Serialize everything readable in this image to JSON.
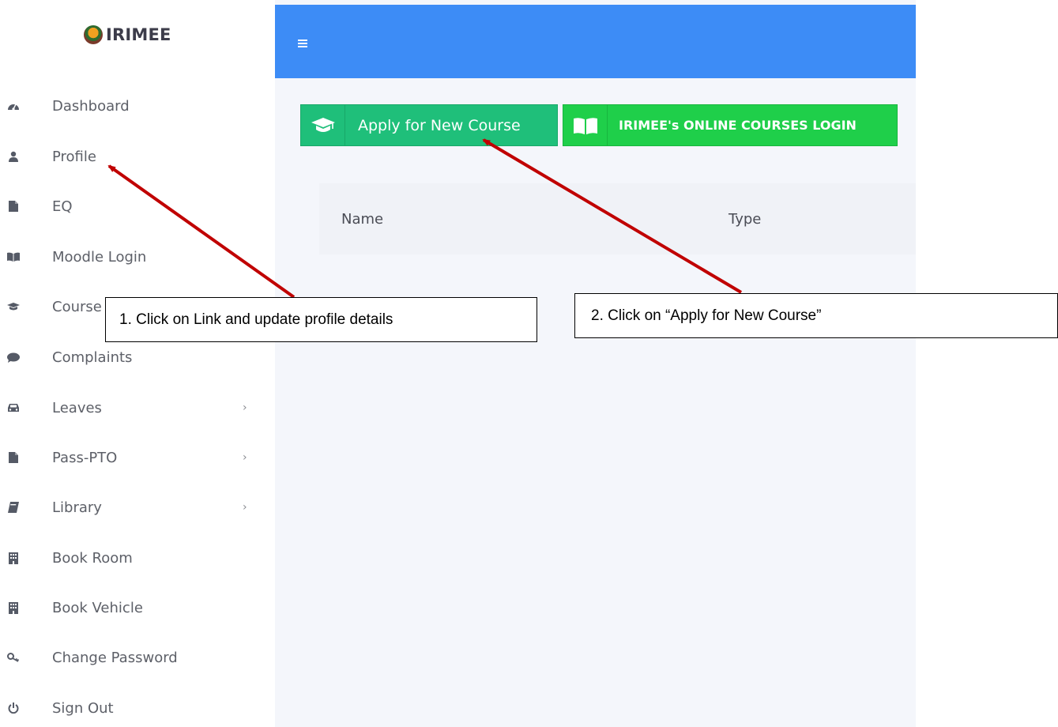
{
  "sidebar": {
    "logo_text": "IRIMEE",
    "items": [
      {
        "label": "Dashboard",
        "icon": "dashboard-icon",
        "has_submenu": false
      },
      {
        "label": "Profile",
        "icon": "user-icon",
        "has_submenu": false
      },
      {
        "label": "EQ",
        "icon": "file-icon",
        "has_submenu": false
      },
      {
        "label": "Moodle Login",
        "icon": "book-open-icon",
        "has_submenu": false
      },
      {
        "label": "Course",
        "icon": "graduation-cap-icon",
        "has_submenu": false
      },
      {
        "label": "Complaints",
        "icon": "comment-icon",
        "has_submenu": false
      },
      {
        "label": "Leaves",
        "icon": "car-icon",
        "has_submenu": true
      },
      {
        "label": "Pass-PTO",
        "icon": "file-icon",
        "has_submenu": true
      },
      {
        "label": "Library",
        "icon": "book-icon",
        "has_submenu": true
      },
      {
        "label": "Book Room",
        "icon": "building-icon",
        "has_submenu": false
      },
      {
        "label": "Book Vehicle",
        "icon": "building-icon",
        "has_submenu": false
      },
      {
        "label": "Change Password",
        "icon": "key-icon",
        "has_submenu": false
      },
      {
        "label": "Sign Out",
        "icon": "power-icon",
        "has_submenu": false
      }
    ],
    "chevron": "›"
  },
  "header": {
    "menu_icon": "hamburger-icon",
    "color": "#3d8cf6"
  },
  "actions": {
    "apply_label": "Apply for New Course",
    "online_label": "IRIMEE's ONLINE COURSES LOGIN",
    "apply_color": "#1fbf7a",
    "online_color": "#1fcf4a"
  },
  "table": {
    "columns": [
      "Name",
      "Type"
    ]
  },
  "annotations": {
    "callout1": "1. Click on Link and update profile details",
    "callout2": "2. Click on “Apply for New Course”",
    "arrow_color": "#c00000"
  }
}
